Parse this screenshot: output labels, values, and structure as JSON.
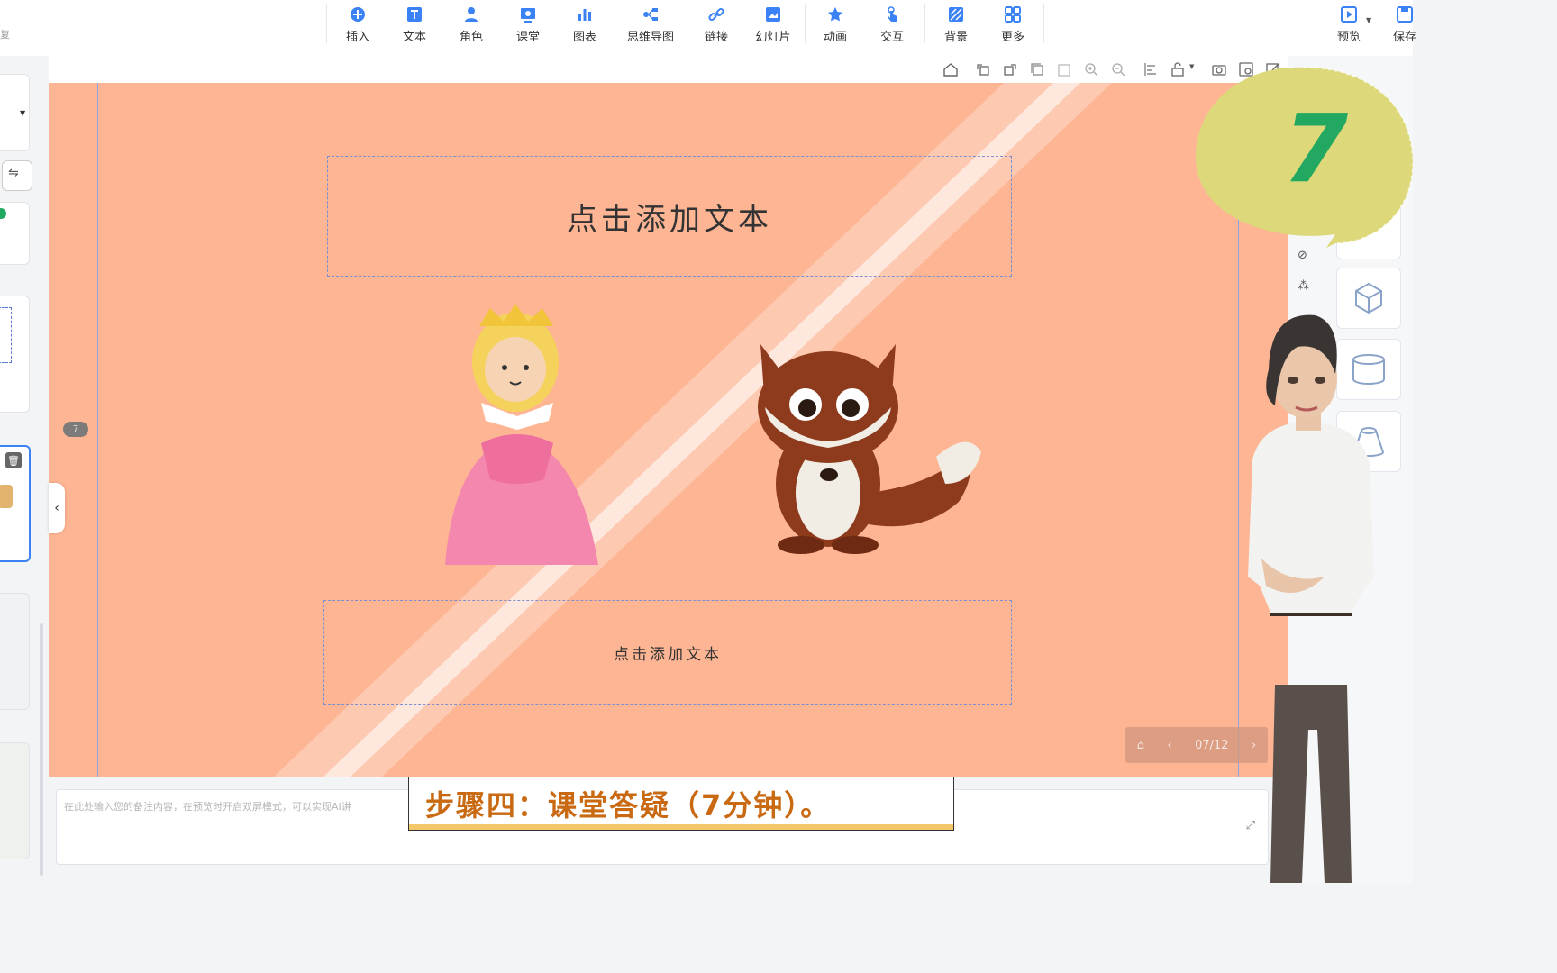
{
  "toolbar": {
    "left_fragment": "复",
    "items": [
      {
        "label": "插入",
        "icon": "plus-circle-icon"
      },
      {
        "label": "文本",
        "icon": "text-icon"
      },
      {
        "label": "角色",
        "icon": "person-icon"
      },
      {
        "label": "课堂",
        "icon": "classroom-icon"
      },
      {
        "label": "图表",
        "icon": "bar-chart-icon"
      },
      {
        "label": "思维导图",
        "icon": "mindmap-icon"
      },
      {
        "label": "链接",
        "icon": "link-icon"
      },
      {
        "label": "幻灯片",
        "icon": "slide-icon"
      },
      {
        "label": "动画",
        "icon": "star-animation-icon"
      },
      {
        "label": "交互",
        "icon": "touch-icon"
      },
      {
        "label": "背景",
        "icon": "background-icon"
      },
      {
        "label": "更多",
        "icon": "grid-more-icon"
      }
    ],
    "preview_label": "预览",
    "save_label": "保存"
  },
  "slide": {
    "title_placeholder": "点击添加文本",
    "body_placeholder": "点击添加文本",
    "page_badge": "7",
    "background_color": "#fdb594"
  },
  "pager": {
    "text": "07/12"
  },
  "notes": {
    "placeholder": "在此处输入您的备注内容，在预览时开启双屏模式，可以实现AI讲"
  },
  "subtitle": {
    "text": "步骤四：课堂答疑（7分钟）。"
  },
  "overlay": {
    "number": "7"
  },
  "colors": {
    "accent": "#3b82f6",
    "subtitle_text": "#c96a13",
    "subtitle_bar": "#f3c66a",
    "badge_green": "#22a861"
  }
}
